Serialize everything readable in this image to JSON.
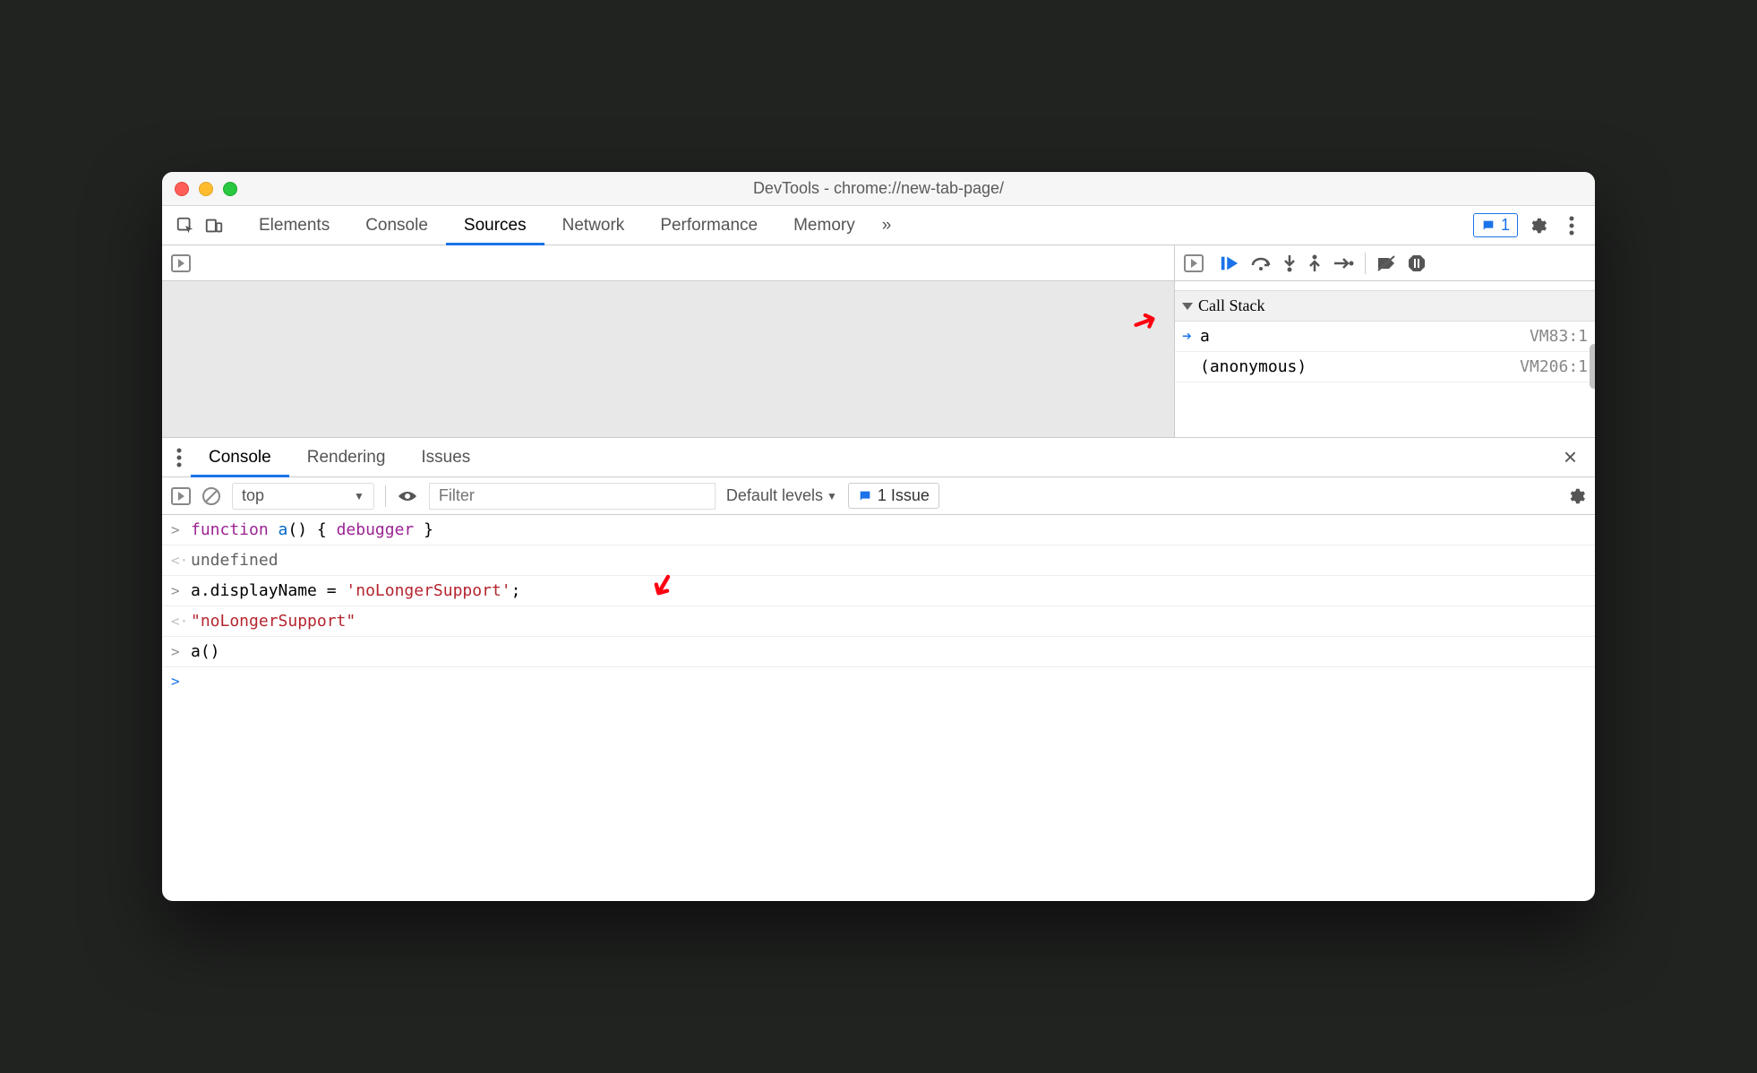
{
  "window": {
    "title": "DevTools - chrome://new-tab-page/"
  },
  "mainTabs": {
    "items": [
      "Elements",
      "Console",
      "Sources",
      "Network",
      "Performance",
      "Memory"
    ],
    "active": "Sources",
    "more": "»",
    "issueCount": "1"
  },
  "debugger": {
    "callStackLabel": "Call Stack",
    "frames": [
      {
        "name": "a",
        "location": "VM83:1",
        "current": true
      },
      {
        "name": "(anonymous)",
        "location": "VM206:1",
        "current": false
      }
    ]
  },
  "drawer": {
    "tabs": [
      "Console",
      "Rendering",
      "Issues"
    ],
    "active": "Console"
  },
  "consoleToolbar": {
    "context": "top",
    "filterPlaceholder": "Filter",
    "levels": "Default levels",
    "issueChip": "1 Issue"
  },
  "consoleLines": [
    {
      "type": "input",
      "html": "<span class='kw'>function</span> <span class='fn'>a</span>() { <span class='dbgr'>debugger</span> }"
    },
    {
      "type": "output",
      "html": "<span class='undef'>undefined</span>"
    },
    {
      "type": "input",
      "html": "a.displayName = <span class='str'>'noLongerSupport'</span>;"
    },
    {
      "type": "output",
      "html": "<span class='str'>\"noLongerSupport\"</span>"
    },
    {
      "type": "input",
      "html": "a()"
    }
  ]
}
